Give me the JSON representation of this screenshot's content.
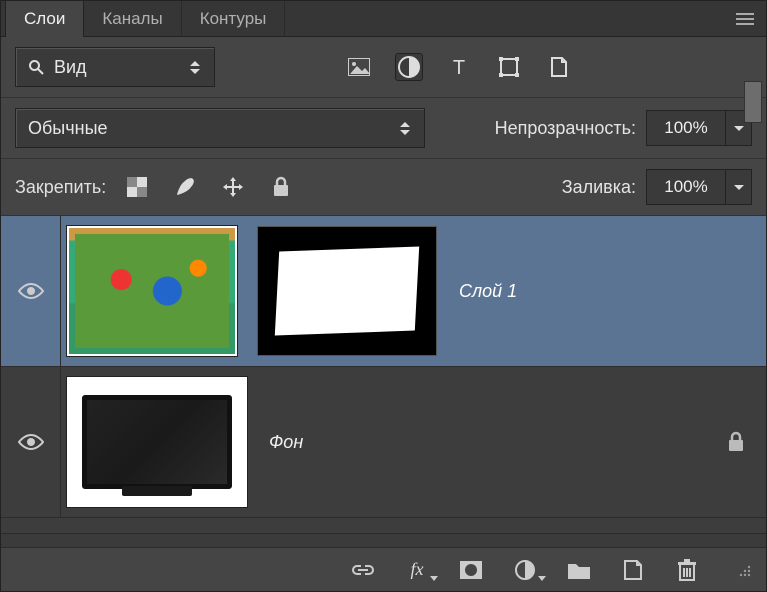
{
  "tabs": {
    "layers": "Слои",
    "channels": "Каналы",
    "paths": "Контуры"
  },
  "filter": {
    "kind_label": "Вид"
  },
  "blend": {
    "mode": "Обычные",
    "opacity_label": "Непрозрачность:",
    "opacity_value": "100%"
  },
  "lock": {
    "label": "Закрепить:",
    "fill_label": "Заливка:",
    "fill_value": "100%"
  },
  "layers": [
    {
      "name": "Слой 1",
      "visible": true,
      "selected": true,
      "has_mask": true,
      "locked": false
    },
    {
      "name": "Фон",
      "visible": true,
      "selected": false,
      "has_mask": false,
      "locked": true
    }
  ]
}
